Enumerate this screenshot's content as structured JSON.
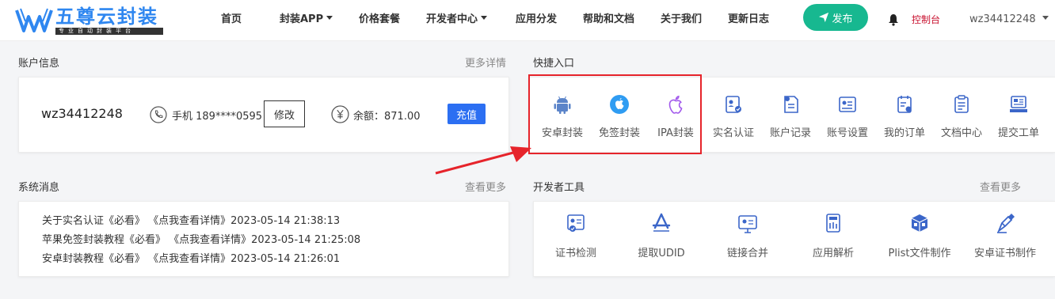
{
  "brand": {
    "name": "五尊云封装",
    "slogan": "专业自动封装平台",
    "color": "#2f87f0"
  },
  "nav": {
    "items": [
      {
        "label": "首页",
        "has_dropdown": false
      },
      {
        "label": "封装APP",
        "has_dropdown": true
      },
      {
        "label": "价格套餐",
        "has_dropdown": false
      },
      {
        "label": "开发者中心",
        "has_dropdown": true
      },
      {
        "label": "应用分发",
        "has_dropdown": false
      },
      {
        "label": "帮助和文档",
        "has_dropdown": false
      },
      {
        "label": "关于我们",
        "has_dropdown": false
      },
      {
        "label": "更新日志",
        "has_dropdown": false
      }
    ],
    "publish_label": "发布",
    "console_label": "控制台",
    "username": "wz34412248"
  },
  "account": {
    "title": "账户信息",
    "more": "更多详情",
    "username": "wz34412248",
    "phone_label": "手机 189****0595",
    "edit_label": "修改",
    "balance_label": "余额：871.00",
    "recharge_label": "充值"
  },
  "quick": {
    "title": "快捷入口",
    "items": [
      {
        "label": "安卓封装",
        "icon": "android-icon"
      },
      {
        "label": "免签封装",
        "icon": "apple-circle-icon"
      },
      {
        "label": "IPA封装",
        "icon": "apple-icon"
      },
      {
        "label": "实名认证",
        "icon": "id-card-icon"
      },
      {
        "label": "账户记录",
        "icon": "account-record-icon"
      },
      {
        "label": "账号设置",
        "icon": "account-settings-icon"
      },
      {
        "label": "我的订单",
        "icon": "order-icon"
      },
      {
        "label": "文档中心",
        "icon": "document-icon"
      },
      {
        "label": "提交工单",
        "icon": "ticket-icon"
      }
    ]
  },
  "messages": {
    "title": "系统消息",
    "more": "查看更多",
    "items": [
      "关于实名认证《必看》 《点我查看详情》2023-05-14 21:38:13",
      "苹果免签封装教程《必看》 《点我查看详情》2023-05-14 21:25:08",
      "安卓封装教程《必看》 《点我查看详情》2023-05-14 21:26:01"
    ]
  },
  "devtools": {
    "title": "开发者工具",
    "more": "查看更多",
    "items": [
      {
        "label": "证书检测",
        "icon": "certificate-check-icon"
      },
      {
        "label": "提取UDID",
        "icon": "app-store-icon"
      },
      {
        "label": "链接合并",
        "icon": "link-merge-icon"
      },
      {
        "label": "应用解析",
        "icon": "app-analysis-icon"
      },
      {
        "label": "Plist文件制作",
        "icon": "plist-icon"
      },
      {
        "label": "安卓证书制作",
        "icon": "android-cert-icon"
      }
    ]
  },
  "colors": {
    "accent": "#2c6ff2",
    "publish": "#17b890",
    "console": "#c8102e",
    "highlight": "#e6242b",
    "icon_blue": "#3b66c9",
    "icon_purple": "#a259ec"
  }
}
